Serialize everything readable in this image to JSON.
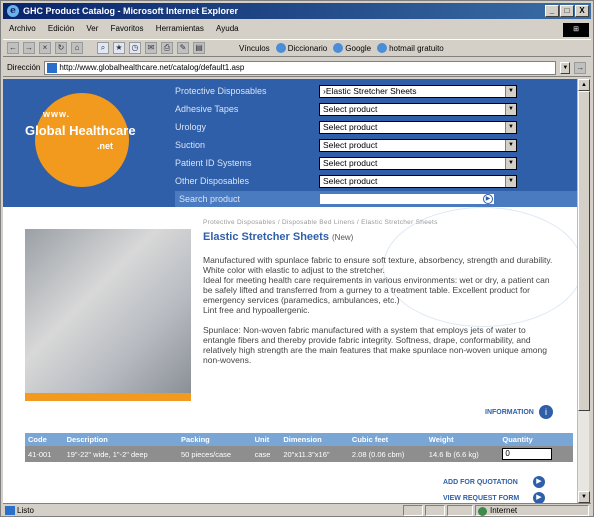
{
  "window": {
    "title": "GHC Product Catalog - Microsoft Internet Explorer",
    "buttons": [
      "_",
      "□",
      "X"
    ]
  },
  "menubar": [
    "Archivo",
    "Edición",
    "Ver",
    "Favoritos",
    "Herramientas",
    "Ayuda"
  ],
  "toolbar": {
    "links_label": "Vínculos",
    "links": [
      "Diccionario",
      "Google",
      "hotmail gratuito"
    ]
  },
  "address": {
    "label": "Dirección",
    "url": "http://www.globalhealthcare.net/catalog/default1.asp"
  },
  "logo": {
    "www": "www.",
    "global": "Global",
    "health": "Health",
    "care": "care",
    "net": ".net"
  },
  "categories": [
    {
      "label": "Protective Disposables",
      "selected": "›Elastic Stretcher Sheets"
    },
    {
      "label": "Adhesive Tapes",
      "selected": "Select product"
    },
    {
      "label": "Urology",
      "selected": "Select product"
    },
    {
      "label": "Suction",
      "selected": "Select product"
    },
    {
      "label": "Patient ID Systems",
      "selected": "Select product"
    },
    {
      "label": "Other Disposables",
      "selected": "Select product"
    }
  ],
  "search": {
    "label": "Search product",
    "value": ""
  },
  "product": {
    "breadcrumb": "Protective Disposables / Disposable Bed Linens / Elastic Stretcher Sheets",
    "title": "Elastic Stretcher Sheets",
    "badge": "(New)",
    "desc1": "Manufactured with spunlace fabric to ensure soft texture, absorbency, strength and durability.",
    "desc2": "White color with elastic to adjust to the stretcher.",
    "desc3": "Ideal for meeting health care requirements in various environments: wet or dry, a patient can be safely lifted and transferred from a gurney to a treatment table. Excellent product for emergency services (paramedics, ambulances, etc.)",
    "desc4": "Lint free and hypoallergenic.",
    "desc5": "Spunlace: Non-woven fabric manufactured with a system that employs jets of water to entangle fibers and thereby provide fabric integrity. Softness, drape, conformability, and relatively high strength are the main features that make spunlace non-woven unique among non-wovens."
  },
  "information_label": "INFORMATION",
  "table": {
    "headers": [
      "Code",
      "Description",
      "Packing",
      "Unit",
      "Dimension",
      "Cubic feet",
      "Weight",
      "Quantity"
    ],
    "row": [
      "41-001",
      "19\"-22\" wide, 1\"-2\" deep",
      "50 pieces/case",
      "case",
      "20\"x11.3\"x16\"",
      "2.08 (0.06 cbm)",
      "14.6 lb (6.6 kg)"
    ],
    "quantity": "0"
  },
  "actions": {
    "quote": "ADD FOR QUOTATION",
    "request": "VIEW REQUEST FORM"
  },
  "status": {
    "text": "Listo",
    "zone": "Internet"
  }
}
